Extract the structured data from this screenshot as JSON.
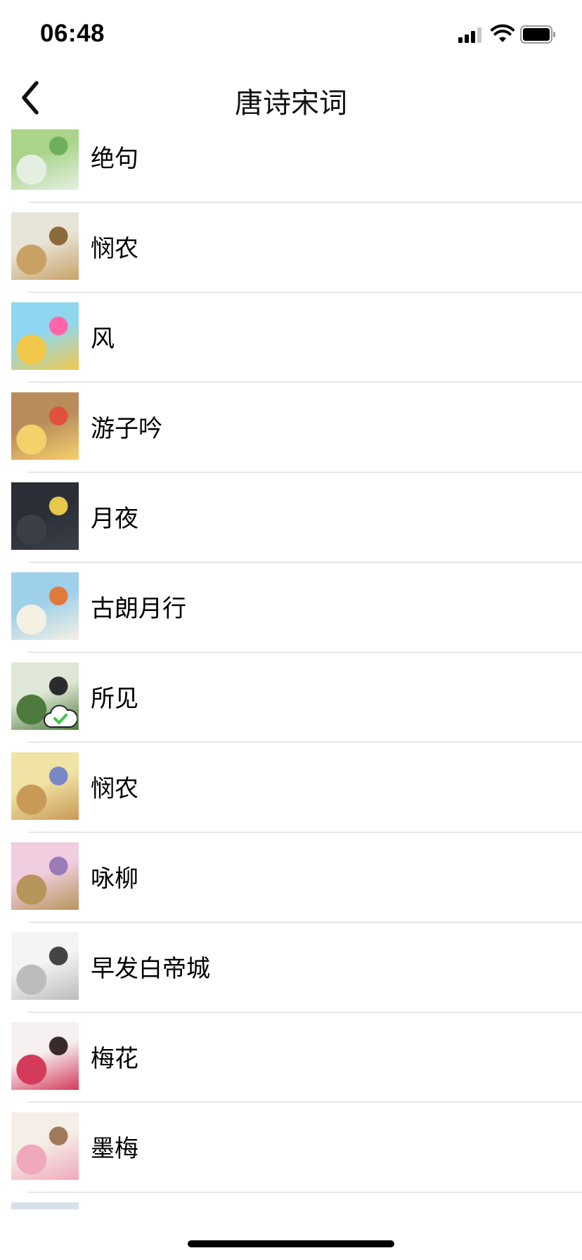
{
  "status_bar": {
    "time": "06:48",
    "signal_icon": "cellular-signal-icon",
    "wifi_icon": "wifi-icon",
    "battery_icon": "battery-icon"
  },
  "nav": {
    "back_icon": "chevron-left-icon",
    "title": "唐诗宋词"
  },
  "poems": [
    {
      "title": "绝句",
      "thumb": [
        "#a9d48a",
        "#e4efe2",
        "#6fae5a"
      ],
      "icon": "landscape-thumbnail"
    },
    {
      "title": "悯农",
      "thumb": [
        "#e8e4d8",
        "#c8a265",
        "#8c6a3c"
      ],
      "icon": "farmer-thumbnail"
    },
    {
      "title": "风",
      "thumb": [
        "#8fd7f0",
        "#f2c84b",
        "#ff66aa"
      ],
      "icon": "birds-thumbnail"
    },
    {
      "title": "游子吟",
      "thumb": [
        "#b98c5c",
        "#f5d16b",
        "#e0503c"
      ],
      "icon": "children-thumbnail"
    },
    {
      "title": "月夜",
      "thumb": [
        "#2a2e36",
        "#3b3f48",
        "#e8c84a"
      ],
      "icon": "moon-night-thumbnail"
    },
    {
      "title": "古朗月行",
      "thumb": [
        "#9fd0ea",
        "#f4f0e4",
        "#e07a3a"
      ],
      "icon": "girl-thumbnail"
    },
    {
      "title": "所见",
      "thumb": [
        "#dfe8d6",
        "#4f7a3e",
        "#2b2b2b"
      ],
      "icon": "cowherd-thumbnail",
      "badge_icon": "cloud-check-icon"
    },
    {
      "title": "悯农",
      "thumb": [
        "#f0e3a5",
        "#c99a56",
        "#7a87c6"
      ],
      "icon": "old-farmer-thumbnail"
    },
    {
      "title": "咏柳",
      "thumb": [
        "#f1cde0",
        "#b6955a",
        "#9b7ab8"
      ],
      "icon": "willow-thumbnail"
    },
    {
      "title": "早发白帝城",
      "thumb": [
        "#f4f4f4",
        "#bcbcbc",
        "#444444"
      ],
      "icon": "mountains-thumbnail"
    },
    {
      "title": "梅花",
      "thumb": [
        "#f6f0f0",
        "#d43a5a",
        "#3a2a2a"
      ],
      "icon": "plum-blossom-thumbnail"
    },
    {
      "title": "墨梅",
      "thumb": [
        "#f5eee6",
        "#f0a8bc",
        "#a07a5a"
      ],
      "icon": "ink-plum-thumbnail"
    },
    {
      "title": "",
      "thumb": [
        "#d8e0ec",
        "#222222",
        "#6a8ab0"
      ],
      "icon": "partial-thumbnail"
    }
  ]
}
